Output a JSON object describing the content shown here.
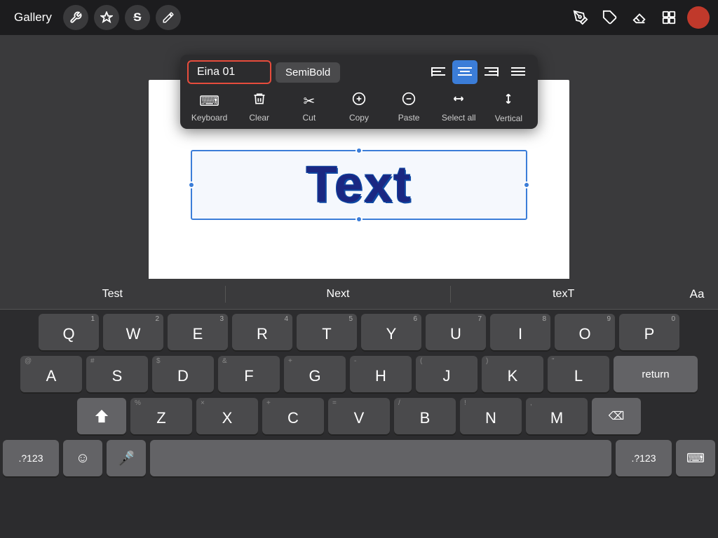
{
  "toolbar": {
    "gallery_label": "Gallery",
    "wrench_icon": "⚙",
    "actions_icon": "✦",
    "stroke_icon": "S",
    "brush_icon": "◈",
    "pencil_icon": "/",
    "eraser_icon": "⬜",
    "layers_icon": "⧉",
    "avatar_color": "#c0392b"
  },
  "context_menu": {
    "font_name": "Eina 01",
    "font_style": "SemiBold",
    "align_left_label": "≡",
    "align_center_label": "≡",
    "align_right_label": "≡",
    "align_justify_label": "≡",
    "actions": [
      {
        "id": "keyboard",
        "icon": "⌨",
        "label": "Keyboard"
      },
      {
        "id": "clear",
        "icon": "✦",
        "label": "Clear"
      },
      {
        "id": "cut",
        "icon": "✂",
        "label": "Cut"
      },
      {
        "id": "copy",
        "icon": "⊕",
        "label": "Copy"
      },
      {
        "id": "paste",
        "icon": "⊖",
        "label": "Paste"
      },
      {
        "id": "select-all",
        "icon": "⟺",
        "label": "Select all"
      },
      {
        "id": "vertical",
        "icon": "⇅",
        "label": "Vertical"
      }
    ]
  },
  "canvas": {
    "text_content": "Text"
  },
  "autocorrect": {
    "suggestions": [
      "Test",
      "Next",
      "texT"
    ],
    "aa_label": "Aa"
  },
  "keyboard": {
    "row1": [
      {
        "num": "1",
        "letter": "Q"
      },
      {
        "num": "2",
        "letter": "W"
      },
      {
        "num": "3",
        "letter": "E"
      },
      {
        "num": "4",
        "letter": "R"
      },
      {
        "num": "5",
        "letter": "T"
      },
      {
        "num": "6",
        "letter": "Y"
      },
      {
        "num": "7",
        "letter": "U"
      },
      {
        "num": "8",
        "letter": "I"
      },
      {
        "num": "9",
        "letter": "O"
      },
      {
        "num": "0",
        "letter": "P"
      }
    ],
    "row2": [
      {
        "sym": "@",
        "letter": "A"
      },
      {
        "sym": "#",
        "letter": "S"
      },
      {
        "sym": "$",
        "letter": "D"
      },
      {
        "sym": "&",
        "letter": "F"
      },
      {
        "sym": "+",
        "letter": "G"
      },
      {
        "sym": "-",
        "letter": "H"
      },
      {
        "sym": "(",
        "letter": "J"
      },
      {
        "sym": ")",
        "letter": "K"
      },
      {
        "sym": "\"",
        "letter": "L"
      }
    ],
    "row3": [
      {
        "sym": "%",
        "letter": "Z"
      },
      {
        "sym": "×",
        "letter": "X"
      },
      {
        "sym": "+",
        "letter": "C"
      },
      {
        "sym": "=",
        "letter": "V"
      },
      {
        "sym": "/",
        "letter": "B"
      },
      {
        "sym": "!",
        "letter": "N"
      },
      {
        "sym": ",",
        "letter": "M"
      }
    ],
    "row4_123": ".?123",
    "row4_emoji": "☺",
    "row4_mic": "🎤",
    "row4_space": " ",
    "row4_123_right": ".?123",
    "row4_keyboard": "⌨",
    "return_label": "return",
    "shift_icon": "⬆",
    "delete_icon": "⌫"
  }
}
